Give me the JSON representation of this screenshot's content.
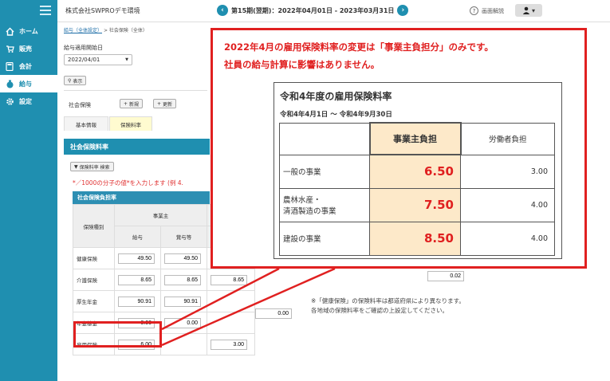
{
  "sidebar": {
    "items": [
      {
        "label": "ホーム",
        "icon": "home-icon"
      },
      {
        "label": "販売",
        "icon": "cart-icon"
      },
      {
        "label": "会計",
        "icon": "calculator-icon"
      },
      {
        "label": "給与",
        "icon": "money-bag-icon"
      },
      {
        "label": "設定",
        "icon": "gear-icon"
      }
    ]
  },
  "header": {
    "company": "株式会社SWPROデモ環境",
    "period": "第15期(翌期)：2022年04月01日 - 2023年03月31日",
    "help_label": "画面解説",
    "user_caret": "▾"
  },
  "breadcrumb": {
    "link": "給与（全体設定）",
    "sep": ">",
    "current": "社会保険（全体）"
  },
  "form": {
    "date_label": "給与適用開始日",
    "date_value": "2022/04/01",
    "show_button": "表示",
    "si_label": "社会保険",
    "new_button": "新規",
    "update_button": "更新"
  },
  "tabs": [
    {
      "label": "基本情報"
    },
    {
      "label": "保険料率"
    }
  ],
  "panel": {
    "title": "社会保険料率",
    "search_button": "保険料率 検索",
    "note": "*／1000の分子の値*を入力します (例 4.",
    "sub_title": "社会保険負担率",
    "col_type": "保険種別",
    "col_employer": "事業主",
    "col_salary": "給与",
    "col_bonus": "賞与等",
    "rows": [
      {
        "name": "健康保険",
        "v1": "49.50",
        "v2": "49.50",
        "v3": ""
      },
      {
        "name": "介護保険",
        "v1": "8.65",
        "v2": "8.65",
        "v3": "8.65"
      },
      {
        "name": "厚生年金",
        "v1": "90.91",
        "v2": "90.91",
        "v3": ""
      },
      {
        "name": "年金基金",
        "v1": "0.00",
        "v2": "0.00",
        "v3": ""
      },
      {
        "name": "雇用保険",
        "v1": "6.00",
        "v2": "",
        "v3": "3.00"
      }
    ],
    "extra_pension_fund": "0.00",
    "extra_right": "0.02"
  },
  "footnote": {
    "line1": "※「健康保険」の保険料率は都道府県により異なります。",
    "line2": "各地域の保険料率をご確認の上設定してください。"
  },
  "callout": {
    "line1": "2022年4月の雇用保険料率の変更は「事業主負担分」のみです。",
    "line2": "社員の給与計算に影響はありません。",
    "table_title": "令和4年度の雇用保険料率",
    "table_period": "令和4年4月1日 ～ 令和4年9月30日",
    "col_employer": "事業主負担",
    "col_worker": "労働者負担",
    "rows": [
      {
        "category": "一般の事業",
        "category2": "",
        "employer": "6.50",
        "worker": "3.00"
      },
      {
        "category": "農林水産・",
        "category2": "清酒製造の事業",
        "employer": "7.50",
        "worker": "4.00"
      },
      {
        "category": "建設の事業",
        "category2": "",
        "employer": "8.50",
        "worker": "4.00"
      }
    ]
  }
}
